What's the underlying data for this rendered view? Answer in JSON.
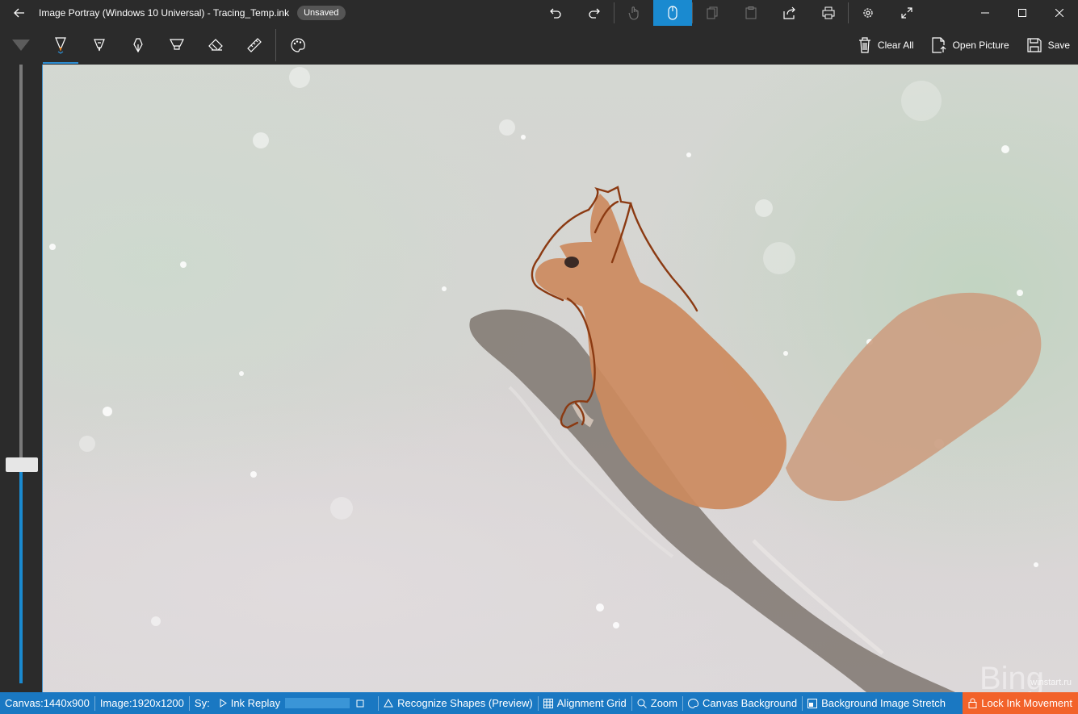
{
  "titlebar": {
    "title": "Image Portray (Windows 10 Universal)  - Tracing_Temp.ink",
    "badge": "Unsaved",
    "icons": [
      "back-arrow-icon",
      "undo-icon",
      "redo-icon",
      "touch-icon",
      "mouse-icon",
      "copy-icon",
      "paste-icon",
      "share-icon",
      "print-icon",
      "settings-icon",
      "fullscreen-icon"
    ],
    "window_buttons": [
      "minimize",
      "maximize",
      "close"
    ]
  },
  "toolbar": {
    "tools": [
      "triangle-icon",
      "pencil-icon",
      "calligraphy-pen-icon",
      "fountain-pen-icon",
      "highlighter-icon",
      "eraser-icon",
      "ruler-icon",
      "palette-icon"
    ],
    "selected_tool": "pencil-icon",
    "clear_all": "Clear All",
    "open_picture": "Open Picture",
    "save": "Save"
  },
  "slider": {
    "value_fraction": 0.35
  },
  "canvas": {
    "subject": "squirrel-photo",
    "ink_color": "#8b3a12",
    "watermark": "Bing",
    "watermark_small": "winstart.ru"
  },
  "statusbar": {
    "canvas": "Canvas:1440x900",
    "image": "Image:1920x1200",
    "sys": "Sy:",
    "ink_replay": "Ink Replay",
    "recognize": "Recognize Shapes (Preview)",
    "grid": "Alignment Grid",
    "zoom": "Zoom",
    "canvas_bg": "Canvas Background",
    "bg_stretch": "Background Image Stretch",
    "lock": "Lock Ink Movement"
  },
  "colors": {
    "accent": "#1a8ad0",
    "statusbar": "#1a78c2",
    "lock": "#f2622a",
    "chrome": "#2b2b2b"
  }
}
